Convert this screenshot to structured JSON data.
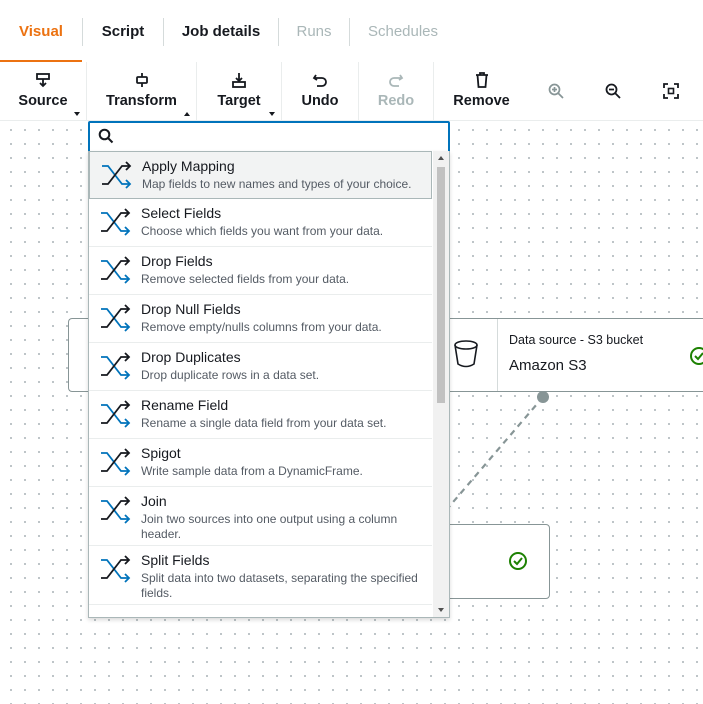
{
  "tabs": {
    "visual": "Visual",
    "script": "Script",
    "job_details": "Job details",
    "runs": "Runs",
    "schedules": "Schedules"
  },
  "toolbar": {
    "source": "Source",
    "transform": "Transform",
    "target": "Target",
    "undo": "Undo",
    "redo": "Redo",
    "remove": "Remove",
    "icons": [
      "source-icon",
      "transform-icon",
      "target-icon",
      "undo-icon",
      "redo-icon",
      "trash-icon",
      "zoom-in-icon",
      "zoom-out-icon",
      "fit-screen-icon"
    ]
  },
  "search": {
    "value": "",
    "placeholder": ""
  },
  "transforms": [
    {
      "title": "Apply Mapping",
      "desc": "Map fields to new names and types of your choice."
    },
    {
      "title": "Select Fields",
      "desc": "Choose which fields you want from your data."
    },
    {
      "title": "Drop Fields",
      "desc": "Remove selected fields from your data."
    },
    {
      "title": "Drop Null Fields",
      "desc": "Remove empty/nulls columns from your data."
    },
    {
      "title": "Drop Duplicates",
      "desc": "Drop duplicate rows in a data set."
    },
    {
      "title": "Rename Field",
      "desc": "Rename a single data field from your data set."
    },
    {
      "title": "Spigot",
      "desc": "Write sample data from a DynamicFrame."
    },
    {
      "title": "Join",
      "desc": "Join two sources into one output using a column header."
    },
    {
      "title": "Split Fields",
      "desc": "Split data into two datasets, separating the specified fields."
    }
  ],
  "canvas": {
    "source_node": {
      "subtitle": "Data source - S3 bucket",
      "title": "Amazon S3",
      "icon": "s3-bucket-icon",
      "status_icon": "check-circle-icon"
    }
  },
  "colors": {
    "accent": "#ec7211",
    "focus": "#0073bb",
    "success": "#1d8102",
    "icon_blue": "#0073bb"
  }
}
